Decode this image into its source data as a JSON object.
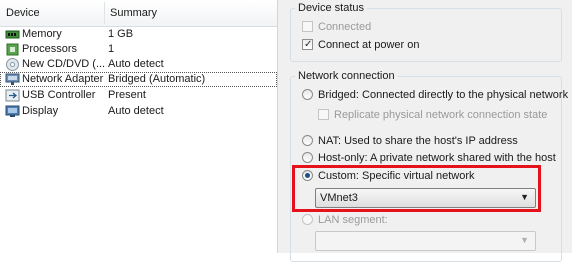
{
  "device_list": {
    "columns": {
      "device": "Device",
      "summary": "Summary"
    },
    "rows": [
      {
        "icon": "memory-icon",
        "device": "Memory",
        "summary": "1 GB"
      },
      {
        "icon": "processor-icon",
        "device": "Processors",
        "summary": "1"
      },
      {
        "icon": "cd-dvd-icon",
        "device": "New CD/DVD (...",
        "summary": "Auto detect"
      },
      {
        "icon": "network-adapter-icon",
        "device": "Network Adapter",
        "summary": "Bridged (Automatic)"
      },
      {
        "icon": "usb-icon",
        "device": "USB Controller",
        "summary": "Present"
      },
      {
        "icon": "display-icon",
        "device": "Display",
        "summary": "Auto detect"
      }
    ],
    "selected_row": "Network Adapter"
  },
  "device_status": {
    "title": "Device status",
    "connected": {
      "label": "Connected",
      "checked": false,
      "enabled": false
    },
    "connect_at_power_on": {
      "label": "Connect at power on",
      "checked": true,
      "enabled": true
    }
  },
  "network_connection": {
    "title": "Network connection",
    "bridged": {
      "label": "Bridged: Connected directly to the physical network",
      "selected": false
    },
    "replicate": {
      "label": "Replicate physical network connection state",
      "checked": false,
      "enabled": false
    },
    "nat": {
      "label": "NAT: Used to share the host's IP address",
      "selected": false
    },
    "host_only": {
      "label": "Host-only: A private network shared with the host",
      "selected": false
    },
    "custom": {
      "label": "Custom: Specific virtual network",
      "selected": true
    },
    "vmnet_select": {
      "value": "VMnet3"
    },
    "lan_segment": {
      "label": "LAN segment:",
      "selected": false
    },
    "lan_select": {
      "value": ""
    }
  },
  "colors": {
    "highlight": "#e5121b",
    "selected_dot": "#1e4e8c"
  }
}
